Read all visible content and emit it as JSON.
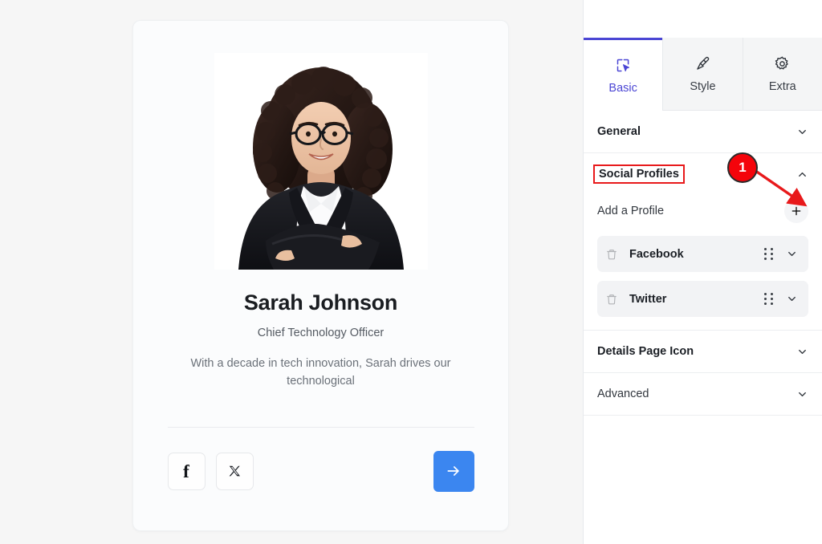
{
  "preview": {
    "card": {
      "photo_alt": "professional-portrait-woman-glasses-black-blazer",
      "name": "Sarah Johnson",
      "role": "Chief Technology Officer",
      "bio": "With a decade in tech innovation, Sarah drives our technological",
      "social_buttons": [
        {
          "name": "facebook",
          "glyph": "f"
        },
        {
          "name": "twitter-x",
          "glyph": "X"
        }
      ],
      "next_button": {
        "icon": "arrow-right-icon",
        "color": "#3b86f0"
      }
    }
  },
  "panel": {
    "tabs": [
      {
        "label": "Basic",
        "icon": "cursor-select-icon",
        "active": true
      },
      {
        "label": "Style",
        "icon": "paintbrush-icon",
        "active": false
      },
      {
        "label": "Extra",
        "icon": "gear-icon",
        "active": false
      }
    ],
    "sections": [
      {
        "title": "General",
        "state": "collapsed",
        "chevron": "chevron-down-icon"
      },
      {
        "title": "Social Profiles",
        "state": "expanded",
        "chevron": "chevron-up-icon",
        "highlighted": true
      },
      {
        "title": "Details Page Icon",
        "state": "collapsed",
        "chevron": "chevron-down-icon"
      },
      {
        "title": "Advanced",
        "state": "collapsed",
        "chevron": "chevron-down-icon"
      }
    ],
    "social_profiles": {
      "add_label": "Add a Profile",
      "add_button_icon": "plus-icon",
      "items": [
        {
          "label": "Facebook",
          "delete_icon": "trash-icon",
          "drag_icon": "drag-handle-icon",
          "chevron": "chevron-down-icon"
        },
        {
          "label": "Twitter",
          "delete_icon": "trash-icon",
          "drag_icon": "drag-handle-icon",
          "chevron": "chevron-down-icon"
        }
      ]
    }
  },
  "annotations": {
    "badge_number": "1",
    "badge_color": "#f4040b",
    "highlight_color": "#e8191b",
    "arrow": {
      "color": "#e8191b",
      "points_to": "add-profile-plus-button"
    }
  }
}
